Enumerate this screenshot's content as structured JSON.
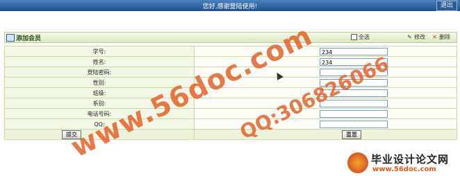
{
  "topbar": {
    "welcome": "您好,感谢登陆使用!",
    "logout_label": "退出"
  },
  "panel": {
    "title": "添加会员",
    "toolbar": {
      "select_all": "全选",
      "edit": "修改",
      "delete": "删除"
    }
  },
  "form": {
    "fields": [
      {
        "label": "学号:",
        "value": "234"
      },
      {
        "label": "姓名:",
        "value": "234"
      },
      {
        "label": "登陆密码:",
        "value": ""
      },
      {
        "label": "性别:",
        "value": ""
      },
      {
        "label": "班级:",
        "value": ""
      },
      {
        "label": "系别:",
        "value": ""
      },
      {
        "label": "电话号码:",
        "value": ""
      },
      {
        "label": "QQ:",
        "value": ""
      }
    ],
    "submit_label": "提交",
    "reset_label": "重置"
  },
  "watermark": {
    "site": "www.56doc.com",
    "qq": "QQ:306826066",
    "brand": "毕业设计论文网",
    "url": "www.56doc.com"
  }
}
